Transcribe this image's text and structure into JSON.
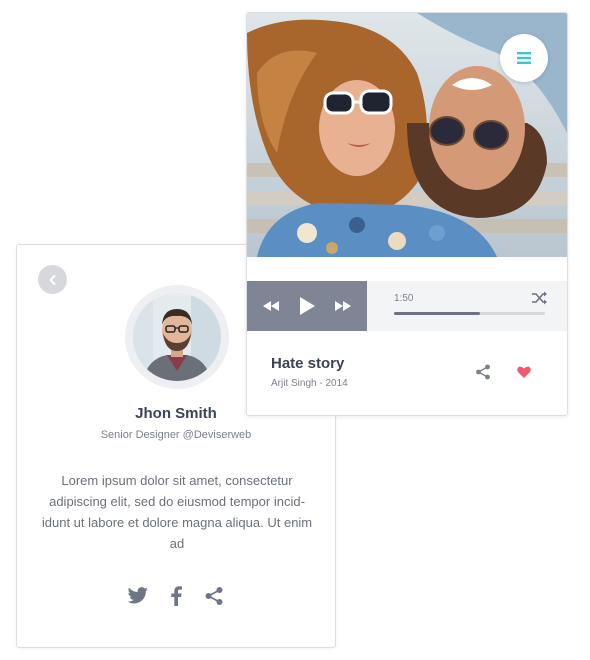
{
  "profile": {
    "name": "Jhon Smith",
    "role": "Senior Designer @Deviserweb",
    "bio": "Lorem ipsum dolor sit amet, consectetur adipiscing elit, sed do eiusmod tempor incid-idunt ut labore et dolore magna aliqua. Ut enim ad",
    "icons": {
      "back": "chevron-left-icon",
      "social": [
        "twitter-icon",
        "facebook-icon",
        "share-icon"
      ]
    }
  },
  "player": {
    "song_title": "Hate story",
    "song_meta": "Arjit Singh - 2014",
    "time": "1:50",
    "progress": 0.57,
    "colors": {
      "accent": "#3cc5d0",
      "controls_bg": "#7f8594",
      "heart": "#f05a6e"
    },
    "icons": {
      "menu": "menu-icon",
      "rewind": "rewind-icon",
      "play": "play-icon",
      "forward": "fast-forward-icon",
      "shuffle": "shuffle-icon",
      "share": "share-icon",
      "like": "heart-icon"
    }
  }
}
